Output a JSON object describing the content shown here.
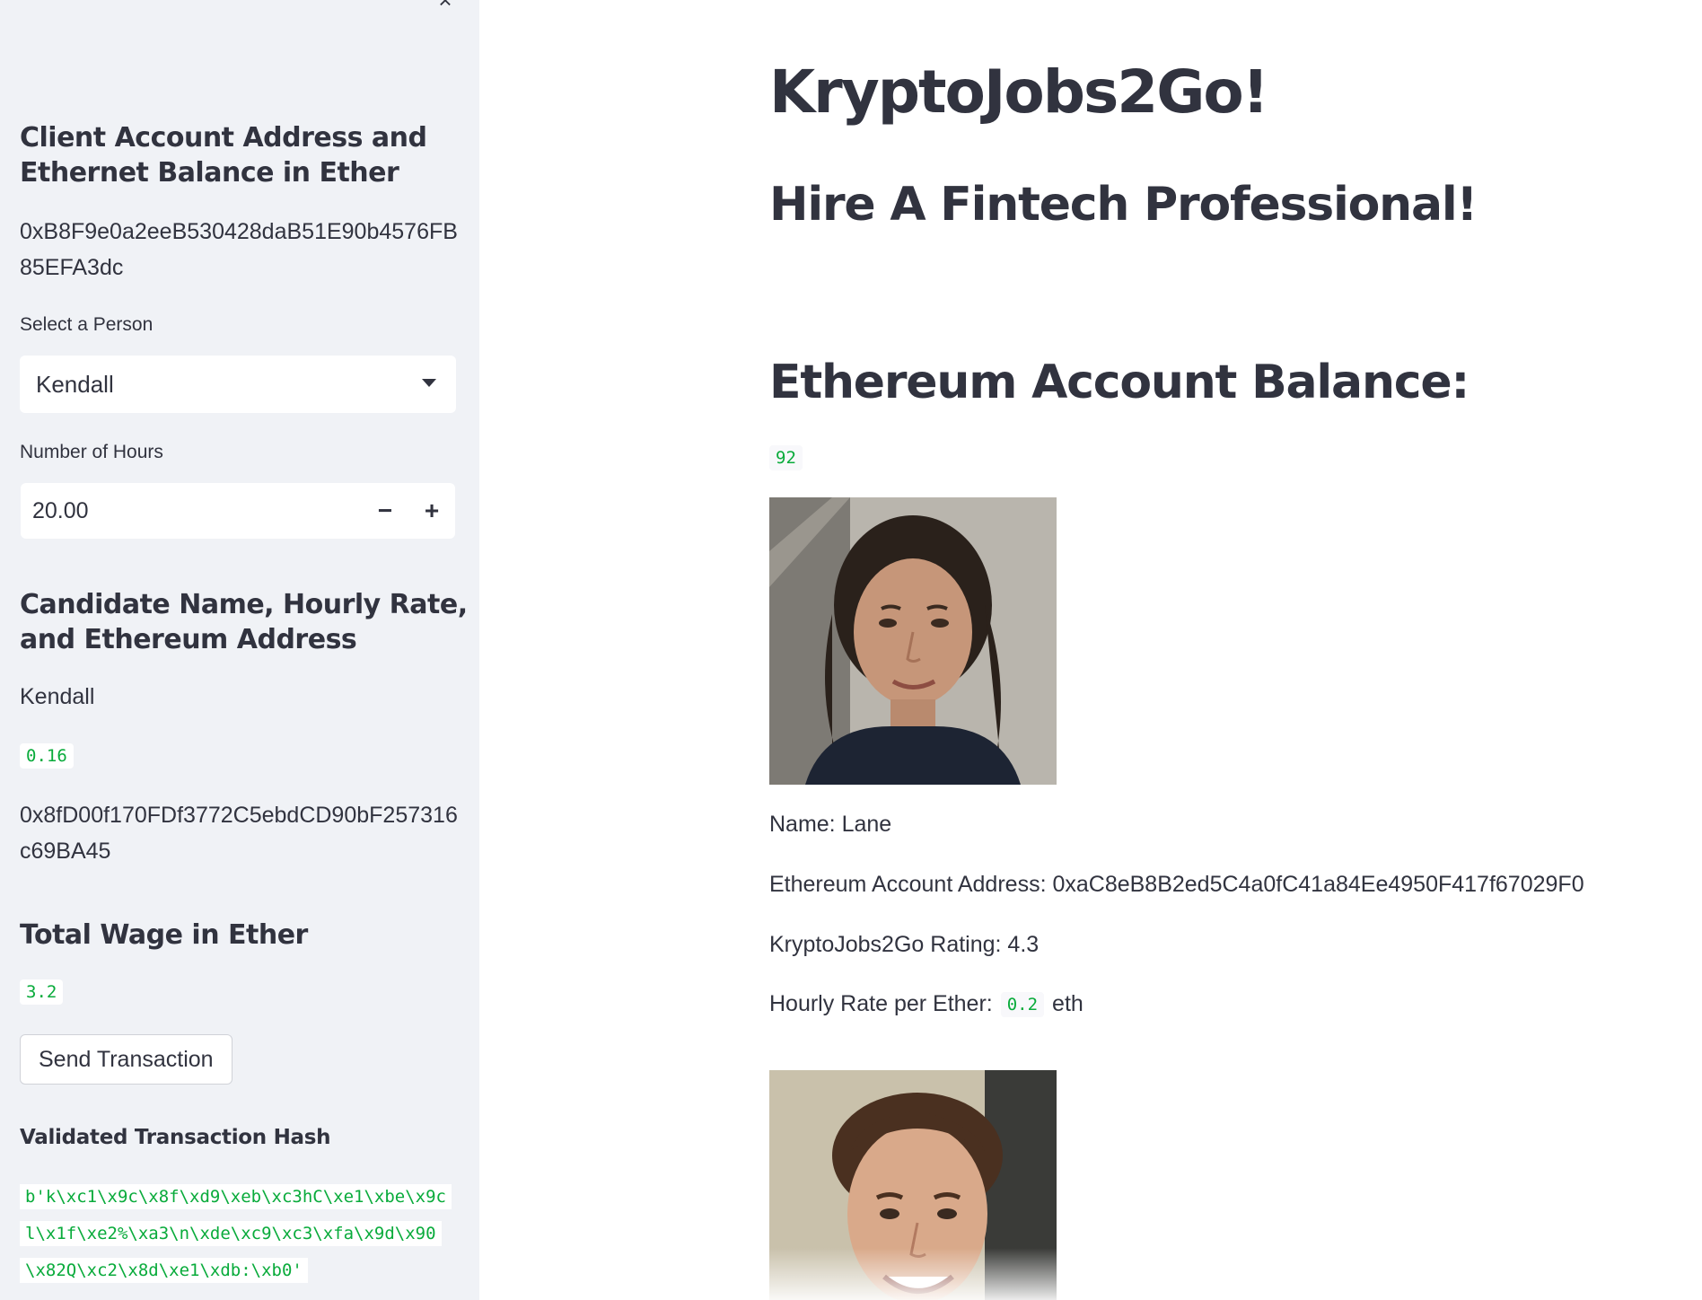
{
  "sidebar": {
    "close_glyph": "×",
    "client_heading": "Client Account Address and Ethernet Balance in Ether",
    "client_address": "0xB8F9e0a2eeB530428daB51E90b4576FB85EFA3dc",
    "select_label": "Select a Person",
    "selected_person": "Kendall",
    "hours_label": "Number of Hours",
    "hours_value": "20.00",
    "minus_glyph": "−",
    "plus_glyph": "+",
    "candidate_heading": "Candidate Name, Hourly Rate, and Ethereum Address",
    "candidate_name": "Kendall",
    "candidate_rate": "0.16",
    "candidate_address": "0x8fD00f170FDf3772C5ebdCD90bF257316c69BA45",
    "total_wage_heading": "Total Wage in Ether",
    "total_wage": "3.2",
    "send_button": "Send Transaction",
    "hash_heading": "Validated Transaction Hash",
    "hash_value": "b'k\\xc1\\x9c\\x8f\\xd9\\xeb\\xc3hC\\xe1\\xbe\\x9cl\\x1f\\xe2%\\xa3\\n\\xde\\xc9\\xc3\\xfa\\x9d\\x90\\x82Q\\xc2\\x8d\\xe1\\xdb:\\xb0'"
  },
  "main": {
    "title": "KryptoJobs2Go!",
    "subtitle": "Hire A Fintech Professional!",
    "balance_heading": "Ethereum Account Balance:",
    "balance_value": "92",
    "candidates": [
      {
        "name_line": "Name: Lane",
        "address_line": "Ethereum Account Address: 0xaC8eB8B2ed5C4a0fC41a84Ee4950F417f67029F0",
        "rating_line": "KryptoJobs2Go Rating: 4.3",
        "rate_prefix": "Hourly Rate per Ether:",
        "rate_value": "0.2",
        "rate_suffix": "eth"
      }
    ]
  },
  "colors": {
    "sidebar_bg": "#f0f2f6",
    "text": "#31333f",
    "code_green": "#09ab3b"
  }
}
